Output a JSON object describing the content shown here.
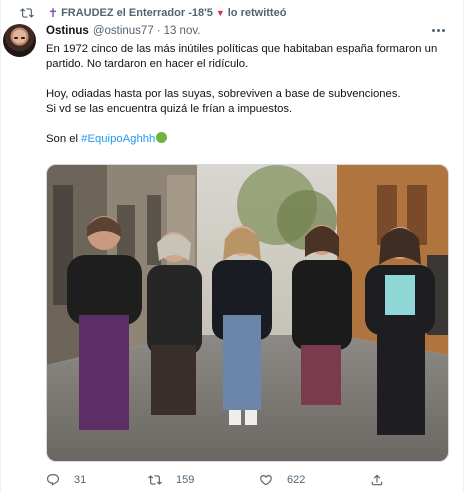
{
  "retweet": {
    "name": "FRAUDEZ el Enterrador -18'5",
    "suffix": "lo retwitteó"
  },
  "tweet": {
    "display_name": "Ostinus",
    "handle": "@ostinus77",
    "separator": "·",
    "date": "13 nov.",
    "line1": "En 1972 cinco de las más inútiles políticas que habitaban españa formaron un partido. No tardaron en hacer el ridículo.",
    "line2a": "Hoy, odiadas hasta por las suyas, sobreviven a base de subvenciones.",
    "line2b": "Si vd se las encuentra quizá le frían a impuestos.",
    "line3_prefix": "Son el ",
    "hashtag": "#EquipoAghhh"
  },
  "actions": {
    "replies": "31",
    "retweets": "159",
    "likes": "622"
  },
  "colors": {
    "link": "#1d9bf0",
    "secondary_text": "#536471",
    "primary_text": "#0f1419",
    "heart_badge": "#e0245e"
  },
  "icons": [
    "retweet-icon",
    "more-icon",
    "reply-icon",
    "like-icon",
    "share-icon",
    "cross-icon",
    "sick-face-emoji"
  ]
}
